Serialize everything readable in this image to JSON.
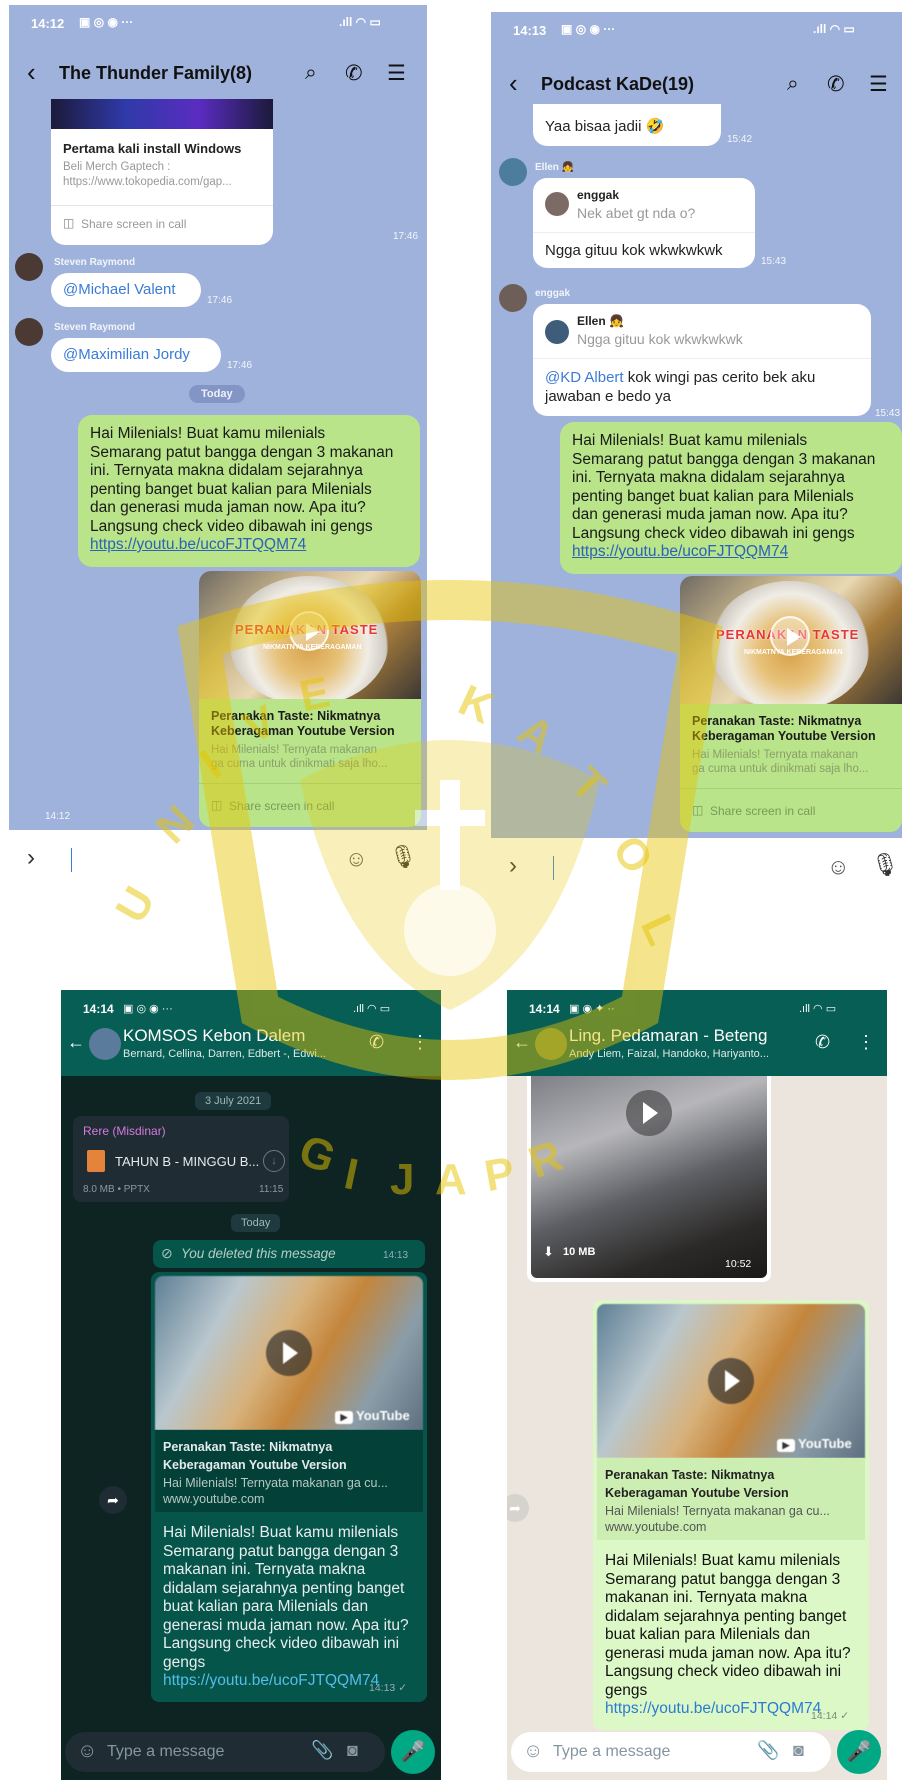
{
  "top_left": {
    "status_time": "14:12",
    "title": "The Thunder Family(8)",
    "link_preview_title": "Pertama kali install Windows",
    "link_preview_desc1": "Beli Merch Gaptech :",
    "link_preview_desc2": "https://www.tokopedia.com/gap...",
    "share_label": "Share screen in call",
    "ts1": "17:46",
    "sender1": "Steven Raymond",
    "mention1": "@Michael Valent",
    "ts2": "17:46",
    "sender2": "Steven Raymond",
    "mention2": "@Maximilian Jordy",
    "ts3": "17:46",
    "today": "Today",
    "message_lines": [
      "Hai Milenials! Buat kamu milenials",
      "Semarang patut bangga dengan 3 makanan",
      "ini. Ternyata makna didalam sejarahnya",
      "penting banget buat kalian para Milenials",
      "dan generasi muda jaman now. Apa itu?",
      "Langsung check video dibawah ini gengs"
    ],
    "link": "https://youtu.be/ucoFJTQQM74",
    "thumb_title": "PERANAKAN TASTE",
    "thumb_sub": "NIKMATNYA KEBERAGAMAN",
    "yt_title_1": "Peranakan Taste: Nikmatnya",
    "yt_title_2": "Keberagaman Youtube Version",
    "yt_desc_1": "Hai Milenials! Ternyata makanan",
    "yt_desc_2": "ga cuma untuk dinikmati saja lho...",
    "yt_share": "Share screen in call",
    "ts4": "14:12"
  },
  "top_right": {
    "status_time": "14:13",
    "title": "Podcast KaDe(19)",
    "msg1": "Yaa bisaa jadii 🤣",
    "ts1": "15:42",
    "sender1": "Ellen 👧",
    "reply1_name": "enggak",
    "reply1_text": "Nek abet gt nda o?",
    "msg2": "Ngga gituu kok wkwkwkwk",
    "ts2": "15:43",
    "sender2": "enggak",
    "reply2_name": "Ellen 👧",
    "reply2_text": "Ngga gituu kok wkwkwkwk",
    "mention": "@KD Albert",
    "msg3_a": " kok wingi pas cerito bek aku",
    "msg3_b": "jawaban e bedo ya",
    "ts3": "15:43",
    "message_lines": [
      "Hai Milenials! Buat kamu milenials",
      "Semarang patut bangga dengan 3 makanan",
      "ini. Ternyata makna didalam sejarahnya",
      "penting banget buat kalian para Milenials",
      "dan generasi muda jaman now. Apa itu?",
      "Langsung check video dibawah ini gengs"
    ],
    "link": "https://youtu.be/ucoFJTQQM74",
    "thumb_title": "PERANAKAN TASTE",
    "thumb_sub": "NIKMATNYA KEBERAGAMAN",
    "yt_title_1": "Peranakan Taste: Nikmatnya",
    "yt_title_2": "Keberagaman Youtube Version",
    "yt_desc_1": "Hai Milenials! Ternyata makanan",
    "yt_desc_2": "ga cuma untuk dinikmati saja lho...",
    "yt_share": "Share screen in call"
  },
  "bottom_left": {
    "status_time": "14:14",
    "group": "KOMSOS Kebon Dalem",
    "members": "Bernard, Cellina, Darren, Edbert -, Edwi...",
    "date": "3 July 2021",
    "sender": "Rere (Misdinar)",
    "file_name": "TAHUN B - MINGGU B...",
    "file_meta": "8.0 MB • PPTX",
    "file_ts": "11:15",
    "today": "Today",
    "deleted": "You deleted this message",
    "deleted_ts": "14:13",
    "yt_title_1": "Peranakan Taste: Nikmatnya",
    "yt_title_2": "Keberagaman Youtube Version",
    "yt_desc": "Hai Milenials! Ternyata makanan ga cu...",
    "yt_site": "www.youtube.com",
    "yt_logo": "YouTube",
    "message_lines": [
      "Hai Milenials! Buat kamu milenials",
      "Semarang patut bangga dengan 3",
      "makanan ini. Ternyata makna",
      "didalam sejarahnya penting banget",
      "buat kalian para Milenials dan",
      "generasi muda jaman now. Apa itu?",
      "Langsung check video dibawah ini",
      "gengs"
    ],
    "link": "https://youtu.be/ucoFJTQQM74",
    "ts": "14:13 ✓",
    "input_placeholder": "Type a message"
  },
  "bottom_right": {
    "status_time": "14:14",
    "group": "Ling. Pedamaran - Beteng",
    "members": "Andy Liem, Faizal, Handoko, Hariyanto...",
    "video_size": "10 MB",
    "video_ts": "10:52",
    "yt_title_1": "Peranakan Taste: Nikmatnya",
    "yt_title_2": "Keberagaman Youtube Version",
    "yt_desc": "Hai Milenials! Ternyata makanan ga cu...",
    "yt_site": "www.youtube.com",
    "yt_logo": "YouTube",
    "message_lines": [
      "Hai Milenials! Buat kamu milenials",
      "Semarang patut bangga dengan 3",
      "makanan ini. Ternyata makna",
      "didalam sejarahnya penting banget",
      "buat kalian para Milenials dan",
      "generasi muda jaman now. Apa itu?",
      "Langsung check video dibawah ini",
      "gengs"
    ],
    "link": "https://youtu.be/ucoFJTQQM74",
    "ts": "14:14 ✓",
    "input_placeholder": "Type a message"
  },
  "watermark": {
    "text": "UNIVERSITAS KATOLIK SOEGIJAPRANATA",
    "color": "#e6c400"
  },
  "colors": {
    "line_bg": "#9fb2dc",
    "line_green": "#b9e489",
    "wa_header": "#075e54",
    "wa_green": "#00a884"
  }
}
